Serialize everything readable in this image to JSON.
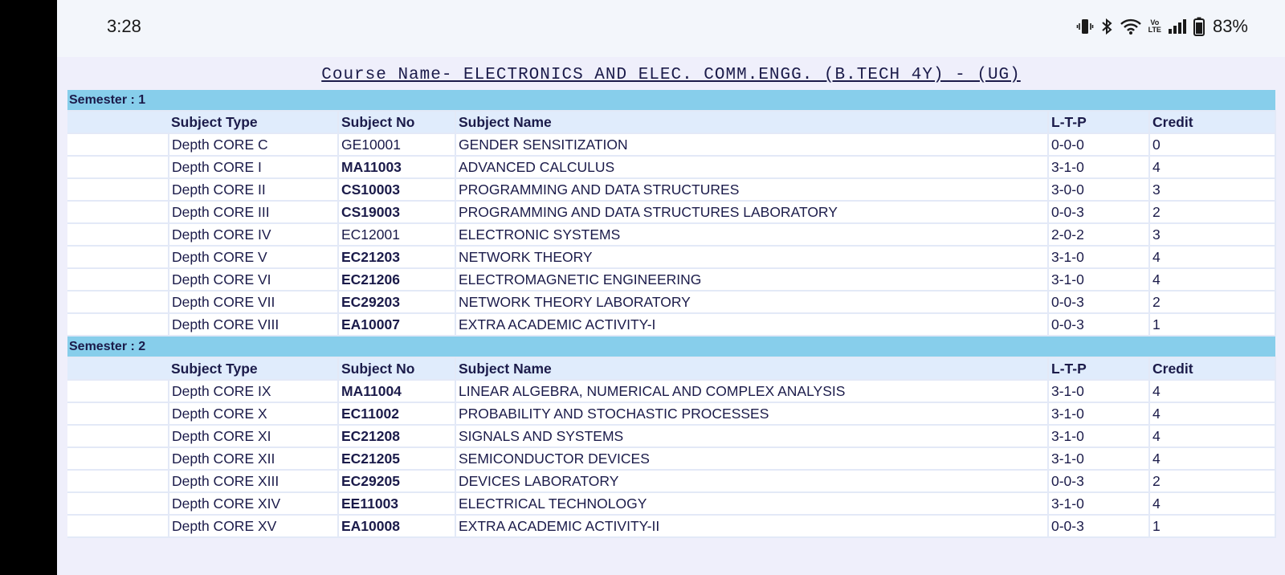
{
  "status": {
    "time": "3:28",
    "battery": "83%",
    "volte_top": "Vo",
    "volte_bottom": "LTE"
  },
  "page": {
    "course_title": "Course Name- ELECTRONICS AND ELEC. COMM.ENGG. (B.TECH 4Y) - (UG)"
  },
  "headers": {
    "subject_type": "Subject Type",
    "subject_no": "Subject No",
    "subject_name": "Subject Name",
    "ltp": "L-T-P",
    "credit": "Credit"
  },
  "semesters": [
    {
      "label": "Semester : 1",
      "rows": [
        {
          "type": "Depth CORE C",
          "no": "GE10001",
          "name": "GENDER SENSITIZATION",
          "ltp": "0-0-0",
          "credit": "0",
          "bold": false
        },
        {
          "type": "Depth CORE I",
          "no": "MA11003",
          "name": "ADVANCED CALCULUS",
          "ltp": "3-1-0",
          "credit": "4",
          "bold": true
        },
        {
          "type": "Depth CORE II",
          "no": "CS10003",
          "name": "PROGRAMMING AND DATA STRUCTURES",
          "ltp": "3-0-0",
          "credit": "3",
          "bold": true
        },
        {
          "type": "Depth CORE III",
          "no": "CS19003",
          "name": "PROGRAMMING AND DATA STRUCTURES LABORATORY",
          "ltp": "0-0-3",
          "credit": "2",
          "bold": true
        },
        {
          "type": "Depth CORE IV",
          "no": "EC12001",
          "name": "ELECTRONIC SYSTEMS",
          "ltp": "2-0-2",
          "credit": "3",
          "bold": false
        },
        {
          "type": "Depth CORE V",
          "no": "EC21203",
          "name": "NETWORK THEORY",
          "ltp": "3-1-0",
          "credit": "4",
          "bold": true
        },
        {
          "type": "Depth CORE VI",
          "no": "EC21206",
          "name": "ELECTROMAGNETIC ENGINEERING",
          "ltp": "3-1-0",
          "credit": "4",
          "bold": true
        },
        {
          "type": "Depth CORE VII",
          "no": "EC29203",
          "name": "NETWORK THEORY LABORATORY",
          "ltp": "0-0-3",
          "credit": "2",
          "bold": true
        },
        {
          "type": "Depth CORE VIII",
          "no": "EA10007",
          "name": "EXTRA ACADEMIC ACTIVITY-I",
          "ltp": "0-0-3",
          "credit": "1",
          "bold": true
        }
      ]
    },
    {
      "label": "Semester : 2",
      "rows": [
        {
          "type": "Depth CORE IX",
          "no": "MA11004",
          "name": "LINEAR ALGEBRA, NUMERICAL AND COMPLEX ANALYSIS",
          "ltp": "3-1-0",
          "credit": "4",
          "bold": true
        },
        {
          "type": "Depth CORE X",
          "no": "EC11002",
          "name": "PROBABILITY AND STOCHASTIC PROCESSES",
          "ltp": "3-1-0",
          "credit": "4",
          "bold": true
        },
        {
          "type": "Depth CORE XI",
          "no": "EC21208",
          "name": "SIGNALS AND SYSTEMS",
          "ltp": "3-1-0",
          "credit": "4",
          "bold": true
        },
        {
          "type": "Depth CORE XII",
          "no": "EC21205",
          "name": "SEMICONDUCTOR DEVICES",
          "ltp": "3-1-0",
          "credit": "4",
          "bold": true
        },
        {
          "type": "Depth CORE XIII",
          "no": "EC29205",
          "name": "DEVICES LABORATORY",
          "ltp": "0-0-3",
          "credit": "2",
          "bold": true
        },
        {
          "type": "Depth CORE XIV",
          "no": "EE11003",
          "name": "ELECTRICAL TECHNOLOGY",
          "ltp": "3-1-0",
          "credit": "4",
          "bold": true
        },
        {
          "type": "Depth CORE XV",
          "no": "EA10008",
          "name": "EXTRA ACADEMIC ACTIVITY-II",
          "ltp": "0-0-3",
          "credit": "1",
          "bold": true
        }
      ]
    }
  ]
}
